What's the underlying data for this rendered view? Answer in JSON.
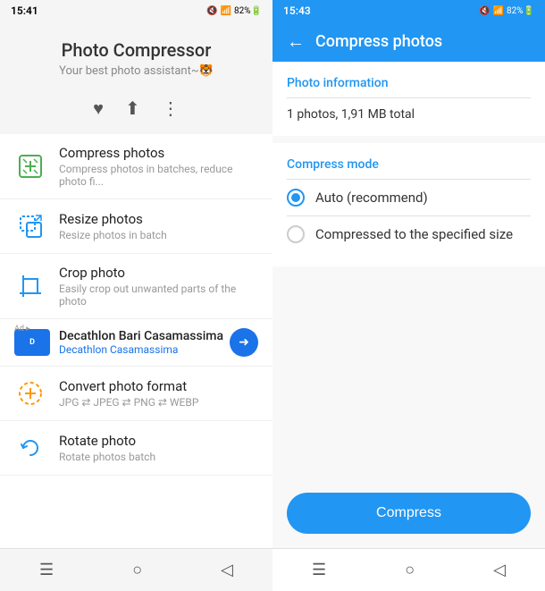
{
  "left": {
    "statusBar": {
      "time": "15:41",
      "icons": "🔇 📶 82%🔋"
    },
    "appTitle": "Photo Compressor",
    "appSubtitle": "Your best photo assistant~🐯",
    "actionIcons": {
      "heart": "♥",
      "share": "⬆",
      "more": "⋮"
    },
    "menuItems": [
      {
        "id": "compress",
        "title": "Compress photos",
        "subtitle": "Compress photos in batches, reduce photo fi...",
        "iconColor": "#4CAF50"
      },
      {
        "id": "resize",
        "title": "Resize photos",
        "subtitle": "Resize photos in batch",
        "iconColor": "#2196F3"
      },
      {
        "id": "crop",
        "title": "Crop photo",
        "subtitle": "Easily crop out unwanted parts of the photo",
        "iconColor": "#2196F3"
      },
      {
        "id": "convert",
        "title": "Convert photo format",
        "subtitle": "JPG ⇄ JPEG ⇄ PNG ⇄ WEBP",
        "iconColor": "#FF9800"
      },
      {
        "id": "rotate",
        "title": "Rotate photo",
        "subtitle": "Rotate photos batch",
        "iconColor": "#2196F3"
      }
    ],
    "adBanner": {
      "title": "Decathlon Bari Casamassima",
      "subtitle": "Decathlon Casamassima",
      "adLabel": "Ad"
    },
    "navBar": {
      "menu": "☰",
      "home": "○",
      "back": "◁"
    }
  },
  "right": {
    "statusBar": {
      "time": "15:43",
      "icons": "🔇 📶 82%🔋"
    },
    "topBar": {
      "backLabel": "←",
      "title": "Compress photos"
    },
    "photoInfo": {
      "sectionTitle": "Photo information",
      "info": "1 photos, 1,91 MB total"
    },
    "compressMode": {
      "sectionTitle": "Compress mode",
      "options": [
        {
          "id": "auto",
          "label": "Auto (recommend)",
          "selected": true
        },
        {
          "id": "specified",
          "label": "Compressed to the specified size",
          "selected": false
        }
      ]
    },
    "compressButton": {
      "label": "Compress"
    },
    "navBar": {
      "menu": "☰",
      "home": "○",
      "back": "◁"
    }
  }
}
